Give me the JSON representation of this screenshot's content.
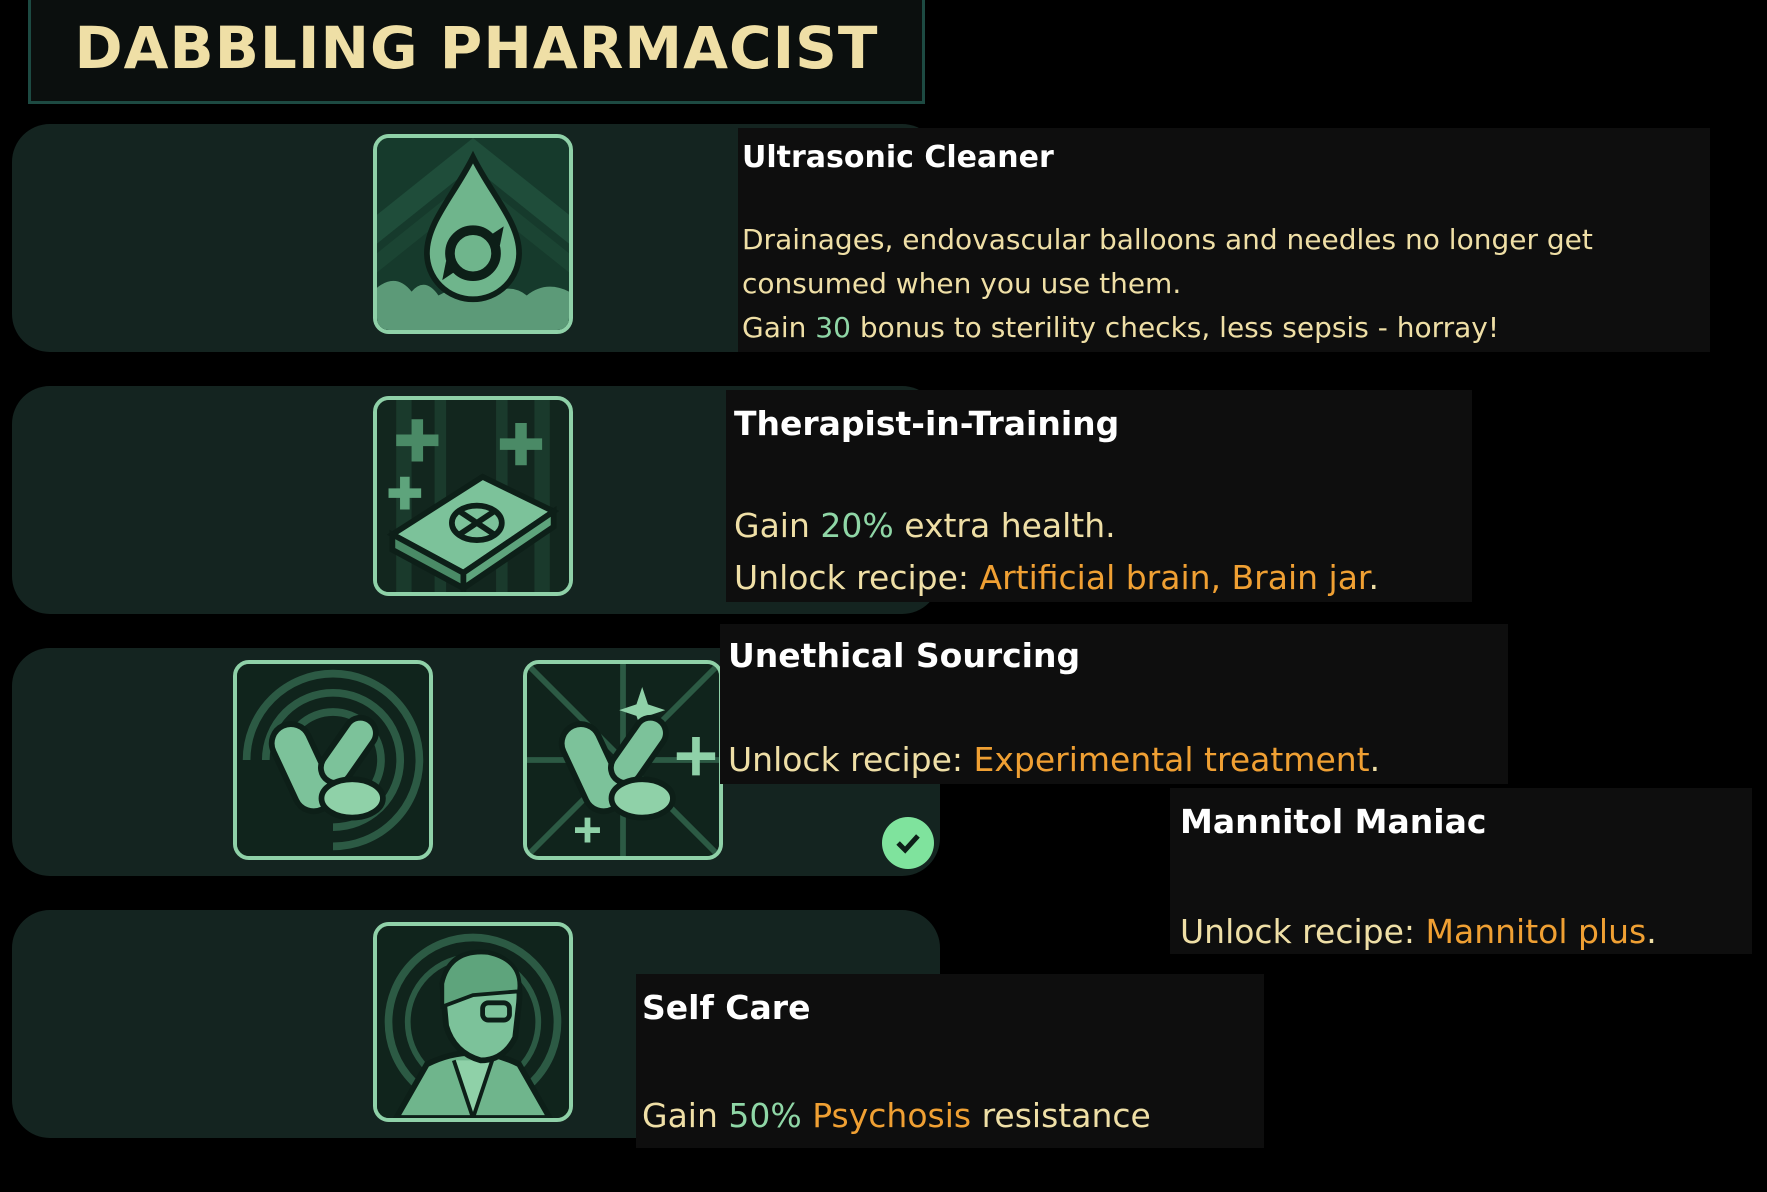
{
  "header": {
    "title": "DABBLING PHARMACIST"
  },
  "icons": {
    "row1": "water-drop-cycle-icon",
    "row2": "medical-book-icon",
    "row3a": "pills-swirl-icon",
    "row3b": "pills-sparkle-icon",
    "row4": "scientist-portrait-icon",
    "check": "checkmark-icon"
  },
  "colors": {
    "accent_green": "#8fd6a6",
    "accent_orange": "#f0a033",
    "text_cream": "#efdfa6",
    "panel_bg": "#142420",
    "icon_border": "#8fd1a8"
  },
  "tooltips": {
    "ultrasonic": {
      "name": "Ultrasonic Cleaner",
      "line1": "Drainages, endovascular balloons and needles no longer get",
      "line2": "consumed when you use them.",
      "line3_pre": "Gain ",
      "line3_value": "30",
      "line3_post": " bonus to sterility checks, less sepsis - horray!"
    },
    "therapist": {
      "name": "Therapist-in-Training",
      "gain_pre": "Gain ",
      "gain_value": "20%",
      "gain_post": " extra health.",
      "unlock_label": "Unlock recipe: ",
      "unlock_value": "Artificial brain, Brain jar",
      "unlock_end": "."
    },
    "unethical": {
      "name": "Unethical Sourcing",
      "unlock_label": "Unlock recipe: ",
      "unlock_value": "Experimental treatment",
      "unlock_end": "."
    },
    "mannitol": {
      "name": "Mannitol Maniac",
      "unlock_label": "Unlock recipe: ",
      "unlock_value": "Mannitol plus",
      "unlock_end": "."
    },
    "selfcare": {
      "name": "Self Care",
      "gain_pre": "Gain ",
      "gain_value": "50%",
      "gain_mid": " ",
      "gain_keyword": "Psychosis",
      "gain_post": " resistance"
    }
  }
}
